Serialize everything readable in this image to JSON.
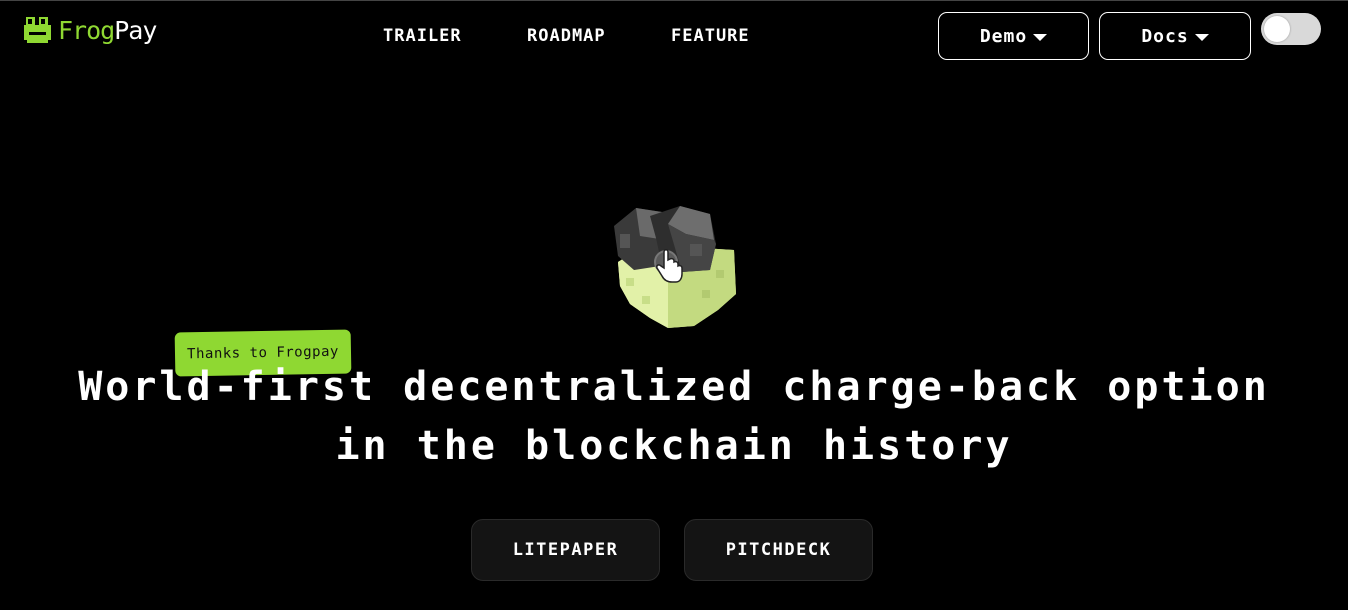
{
  "brand": {
    "logo_part1": "Frog",
    "logo_part2": "Pay",
    "accent_color": "#8fd832",
    "logo_icon": "frog-icon"
  },
  "nav": {
    "items": [
      {
        "label": "TRAILER"
      },
      {
        "label": "ROADMAP"
      },
      {
        "label": "FEATURE"
      }
    ]
  },
  "header": {
    "demo_label": "Demo",
    "docs_label": "Docs",
    "dropdown_icon": "chevron-down-icon",
    "theme_toggle_state": "off"
  },
  "hero": {
    "art_icon": "voxel-frog-hand-icon",
    "tag_text": "Thanks to Frogpay",
    "headline_line1": "World-first decentralized charge-back option",
    "headline_line2": "in the blockchain history",
    "buttons": [
      {
        "label": "LITEPAPER"
      },
      {
        "label": "PITCHDECK"
      }
    ]
  }
}
